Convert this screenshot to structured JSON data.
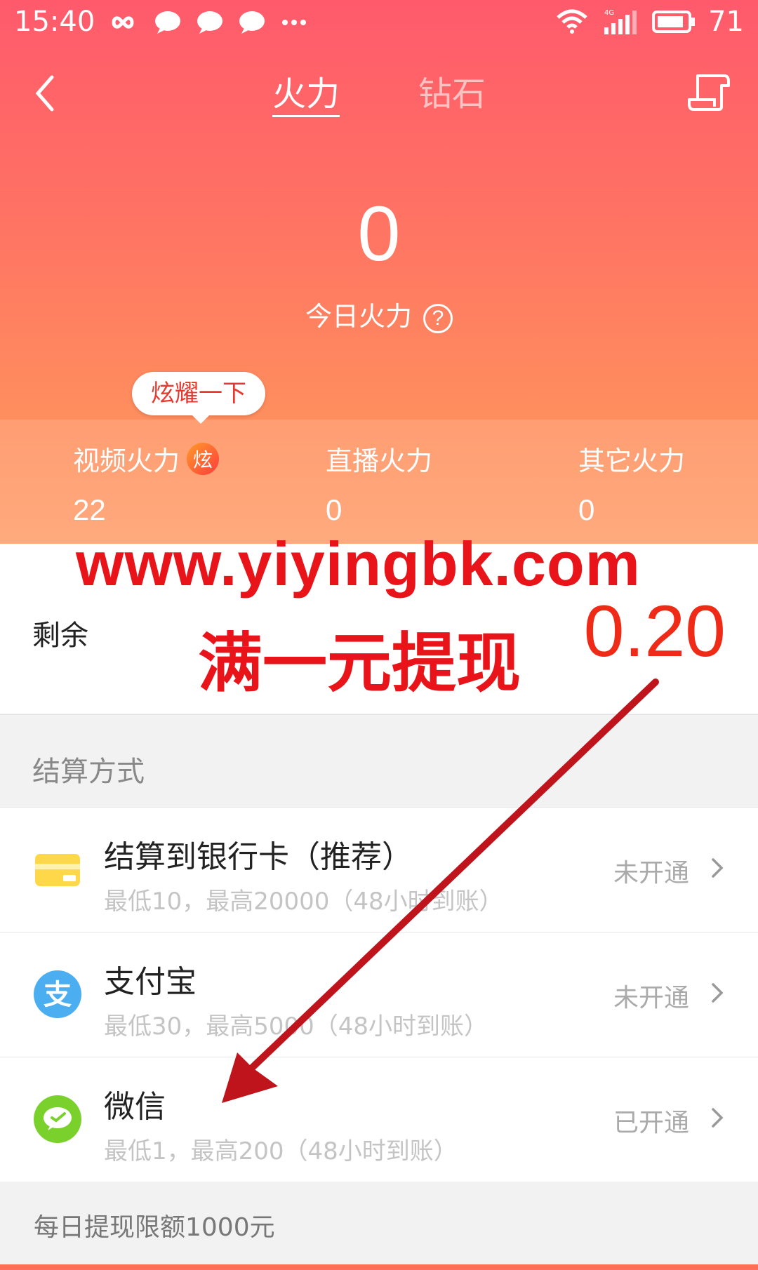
{
  "status_bar": {
    "time": "15:40",
    "battery": "71",
    "network": "4G"
  },
  "nav": {
    "tabs": [
      {
        "label": "火力",
        "active": true
      },
      {
        "label": "钻石",
        "active": false
      }
    ]
  },
  "summary": {
    "today_value": "0",
    "today_label": "今日火力",
    "help_glyph": "?",
    "bubble_text": "炫耀一下"
  },
  "stats": {
    "video": {
      "label": "视频火力",
      "badge": "炫",
      "value": "22"
    },
    "live": {
      "label": "直播火力",
      "value": "0"
    },
    "other": {
      "label": "其它火力",
      "value": "0"
    }
  },
  "remain": {
    "label": "剩余",
    "amount": "0.20"
  },
  "watermark": {
    "url": "www.yiyingbk.com",
    "promo": "满一元提现",
    "color": "#e8141a"
  },
  "settle": {
    "title": "结算方式",
    "methods": [
      {
        "name": "结算到银行卡（推荐）",
        "desc": "最低10，最高20000（48小时到账）",
        "status": "未开通",
        "icon": "bank-card-icon"
      },
      {
        "name": "支付宝",
        "desc": "最低30，最高5000（48小时到账）",
        "status": "未开通",
        "icon": "alipay-icon"
      },
      {
        "name": "微信",
        "desc": "最低1，最高200（48小时到账）",
        "status": "已开通",
        "icon": "wechat-icon"
      }
    ],
    "daily_limit": "每日提现限额1000元"
  },
  "colors": {
    "header_top": "#ff5a6c",
    "header_bottom": "#ffa16e",
    "amount": "#ef2a17",
    "arrow": "#c0141c"
  }
}
